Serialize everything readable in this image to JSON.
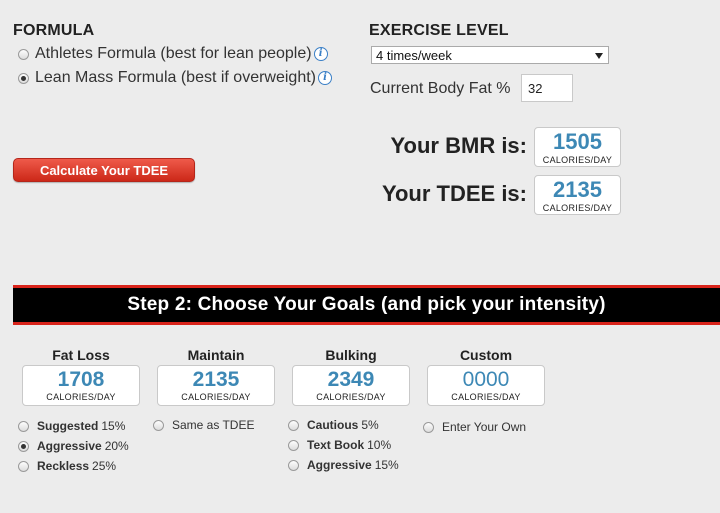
{
  "formula": {
    "title": "FORMULA",
    "options": [
      {
        "label": "Athletes Formula (best for lean people)",
        "checked": false
      },
      {
        "label": "Lean Mass Formula (best if overweight)",
        "checked": true
      }
    ],
    "info_glyph": "i"
  },
  "exercise": {
    "title": "EXERCISE LEVEL",
    "selected": "4 times/week",
    "body_fat_label": "Current Body Fat %",
    "body_fat_value": "32"
  },
  "calculate_label": "Calculate Your TDEE",
  "results": {
    "bmr_label": "Your BMR is:",
    "bmr_value": "1505",
    "tdee_label": "Your TDEE is:",
    "tdee_value": "2135",
    "unit": "CALORIES/DAY"
  },
  "step2": {
    "title": "Step 2: Choose Your Goals (and pick your intensity)"
  },
  "goals": [
    {
      "title": "Fat Loss",
      "value": "1708",
      "unit": "CALORIES/DAY",
      "options": [
        {
          "bold": "Suggested",
          "pct": "15%",
          "checked": false
        },
        {
          "bold": "Aggressive",
          "pct": "20%",
          "checked": true
        },
        {
          "bold": "Reckless",
          "pct": "25%",
          "checked": false
        }
      ]
    },
    {
      "title": "Maintain",
      "value": "2135",
      "unit": "CALORIES/DAY",
      "options": [
        {
          "bold": "",
          "pct": "Same as TDEE",
          "checked": false
        }
      ]
    },
    {
      "title": "Bulking",
      "value": "2349",
      "unit": "CALORIES/DAY",
      "options": [
        {
          "bold": "Cautious",
          "pct": "5%",
          "checked": false
        },
        {
          "bold": "Text Book",
          "pct": "10%",
          "checked": false
        },
        {
          "bold": "Aggressive",
          "pct": "15%",
          "checked": false
        }
      ]
    },
    {
      "title": "Custom",
      "value": "0000",
      "unit": "CALORIES/DAY",
      "options": [
        {
          "bold": "",
          "pct": "Enter Your Own",
          "checked": false
        }
      ]
    }
  ],
  "colors": {
    "accent_red": "#d9241b",
    "value_blue": "#3d88b5",
    "info_blue": "#3a7fc6"
  }
}
